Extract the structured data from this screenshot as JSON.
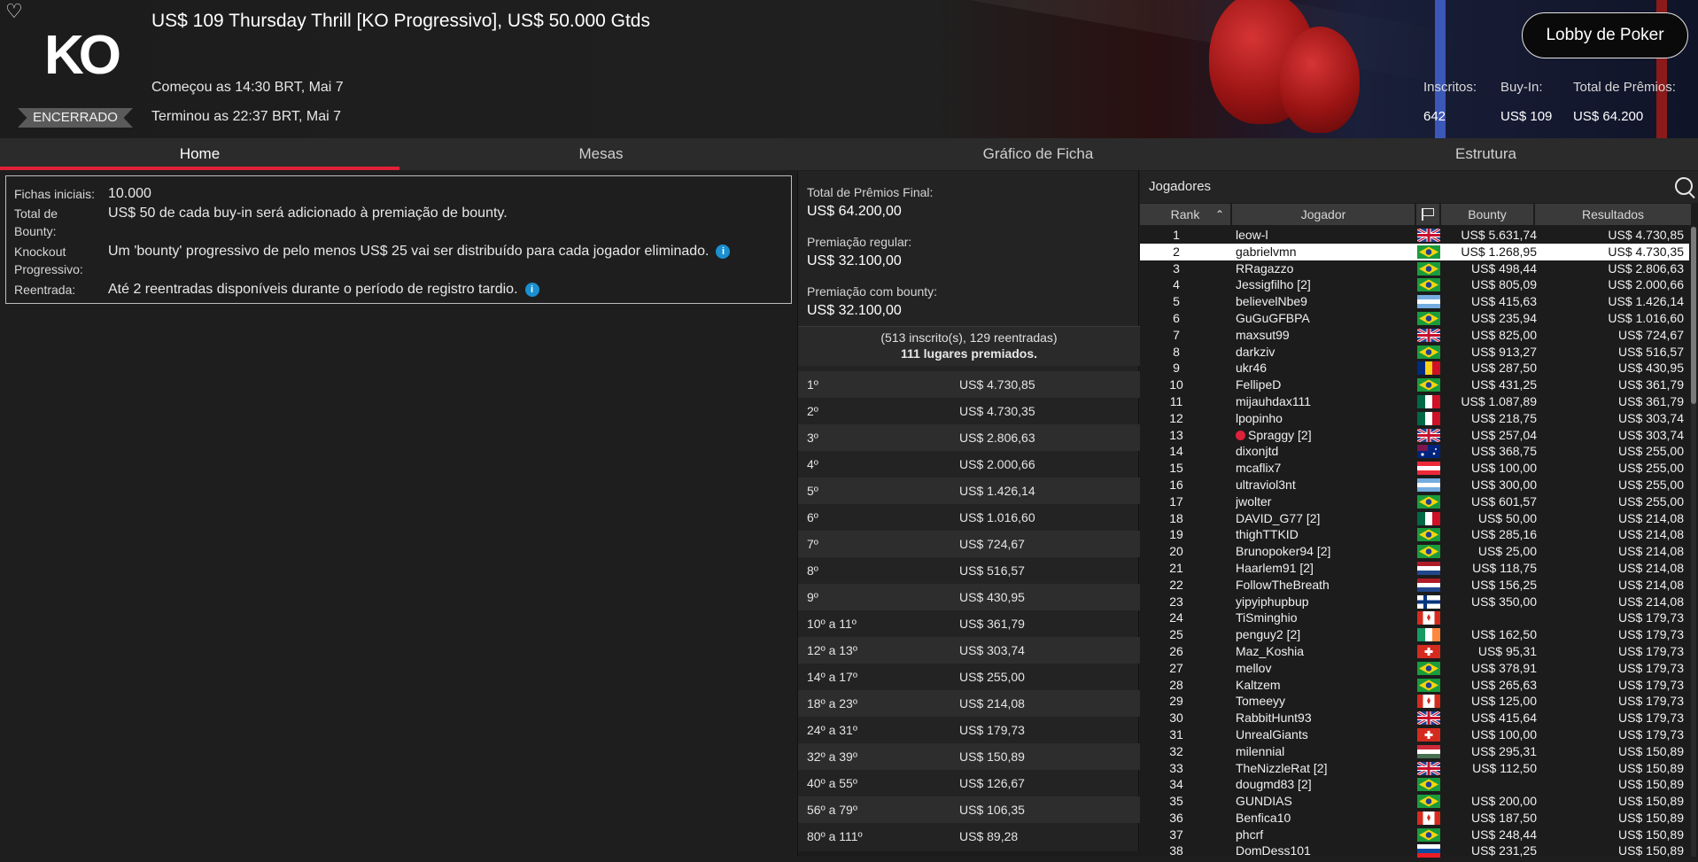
{
  "header": {
    "title": "US$ 109 Thursday Thrill [KO Progressivo], US$ 50.000 Gtds",
    "logo_text": "KO",
    "status": "ENCERRADO",
    "started": "Começou as 14:30 BRT, Mai 7",
    "ended": "Terminou as 22:37 BRT, Mai 7",
    "lobby_button": "Lobby de Poker",
    "stats": {
      "entrants_label": "Inscritos:",
      "entrants_value": "642",
      "buyin_label": "Buy-In:",
      "buyin_value": "US$ 109",
      "prize_label": "Total de Prêmios:",
      "prize_value": "US$ 64.200"
    }
  },
  "tabs": [
    "Home",
    "Mesas",
    "Gráfico de Ficha",
    "Estrutura"
  ],
  "info": [
    {
      "label": "Fichas iniciais:",
      "value": "10.000",
      "icon": false
    },
    {
      "label": "Total de Bounty:",
      "value": "US$ 50 de cada buy-in será adicionado à premiação de bounty.",
      "icon": false
    },
    {
      "label": "Knockout Progressivo:",
      "value": "Um 'bounty' progressivo de pelo menos US$ 25 vai ser distribuído para cada jogador eliminado.",
      "icon": true
    },
    {
      "label": "Reentrada:",
      "value": "Até 2 reentradas disponíveis durante o período de registro tardio.",
      "icon": true
    }
  ],
  "prizes": {
    "final_label": "Total de Prêmios Final:",
    "final_value": "US$ 64.200,00",
    "regular_label": "Premiação regular:",
    "regular_value": "US$ 32.100,00",
    "bounty_label": "Premiação com bounty:",
    "bounty_value": "US$ 32.100,00",
    "entries_line": "(513 inscrito(s), 129 reentradas)",
    "paid_line": "111 lugares premiados.",
    "payouts": [
      {
        "place": "1º",
        "amount": "US$ 4.730,85"
      },
      {
        "place": "2º",
        "amount": "US$ 4.730,35"
      },
      {
        "place": "3º",
        "amount": "US$ 2.806,63"
      },
      {
        "place": "4º",
        "amount": "US$ 2.000,66"
      },
      {
        "place": "5º",
        "amount": "US$ 1.426,14"
      },
      {
        "place": "6º",
        "amount": "US$ 1.016,60"
      },
      {
        "place": "7º",
        "amount": "US$ 724,67"
      },
      {
        "place": "8º",
        "amount": "US$ 516,57"
      },
      {
        "place": "9º",
        "amount": "US$ 430,95"
      },
      {
        "place": "10º a 11º",
        "amount": "US$ 361,79"
      },
      {
        "place": "12º a 13º",
        "amount": "US$ 303,74"
      },
      {
        "place": "14º a 17º",
        "amount": "US$ 255,00"
      },
      {
        "place": "18º a 23º",
        "amount": "US$ 214,08"
      },
      {
        "place": "24º a 31º",
        "amount": "US$ 179,73"
      },
      {
        "place": "32º a 39º",
        "amount": "US$ 150,89"
      },
      {
        "place": "40º a 55º",
        "amount": "US$ 126,67"
      },
      {
        "place": "56º a 79º",
        "amount": "US$ 106,35"
      },
      {
        "place": "80º a 111º",
        "amount": "US$ 89,28"
      }
    ]
  },
  "players": {
    "title": "Jogadores",
    "columns": [
      "Rank",
      "Jogador",
      "Bounty",
      "Resultados"
    ],
    "rows": [
      {
        "rank": "1",
        "name": "leow-l",
        "flag": "gb",
        "bounty": "US$ 5.631,74",
        "result": "US$ 4.730,85"
      },
      {
        "rank": "2",
        "name": "gabrielvmn",
        "flag": "br",
        "bounty": "US$ 1.268,95",
        "result": "US$ 4.730,35"
      },
      {
        "rank": "3",
        "name": "RRagazzo",
        "flag": "br",
        "bounty": "US$ 498,44",
        "result": "US$ 2.806,63"
      },
      {
        "rank": "4",
        "name": "Jessigfilho [2]",
        "flag": "br",
        "bounty": "US$ 805,09",
        "result": "US$ 2.000,66"
      },
      {
        "rank": "5",
        "name": "believelNbe9",
        "flag": "ar",
        "bounty": "US$ 415,63",
        "result": "US$ 1.426,14"
      },
      {
        "rank": "6",
        "name": "GuGuGFBPA",
        "flag": "br",
        "bounty": "US$ 235,94",
        "result": "US$ 1.016,60"
      },
      {
        "rank": "7",
        "name": "maxsut99",
        "flag": "gb",
        "bounty": "US$ 825,00",
        "result": "US$ 724,67"
      },
      {
        "rank": "8",
        "name": "darkziv",
        "flag": "br",
        "bounty": "US$ 913,27",
        "result": "US$ 516,57"
      },
      {
        "rank": "9",
        "name": "ukr46",
        "flag": "ro",
        "bounty": "US$ 287,50",
        "result": "US$ 430,95"
      },
      {
        "rank": "10",
        "name": "FellipeD",
        "flag": "br",
        "bounty": "US$ 431,25",
        "result": "US$ 361,79"
      },
      {
        "rank": "11",
        "name": "mijauhdax111",
        "flag": "mx",
        "bounty": "US$ 1.087,89",
        "result": "US$ 361,79"
      },
      {
        "rank": "12",
        "name": "lpopinho",
        "flag": "mx",
        "bounty": "US$ 218,75",
        "result": "US$ 303,74"
      },
      {
        "rank": "13",
        "name": "Spraggy [2]",
        "flag": "gb",
        "bounty": "US$ 257,04",
        "result": "US$ 303,74",
        "pro": true
      },
      {
        "rank": "14",
        "name": "dixonjtd",
        "flag": "au",
        "bounty": "US$ 368,75",
        "result": "US$ 255,00"
      },
      {
        "rank": "15",
        "name": "mcaflix7",
        "flag": "at",
        "bounty": "US$ 100,00",
        "result": "US$ 255,00"
      },
      {
        "rank": "16",
        "name": "ultraviol3nt",
        "flag": "ar",
        "bounty": "US$ 300,00",
        "result": "US$ 255,00"
      },
      {
        "rank": "17",
        "name": "jwolter",
        "flag": "br",
        "bounty": "US$ 601,57",
        "result": "US$ 255,00"
      },
      {
        "rank": "18",
        "name": "DAVID_G77 [2]",
        "flag": "mx",
        "bounty": "US$ 50,00",
        "result": "US$ 214,08"
      },
      {
        "rank": "19",
        "name": "thighTTKID",
        "flag": "br",
        "bounty": "US$ 285,16",
        "result": "US$ 214,08"
      },
      {
        "rank": "20",
        "name": "Brunopoker94 [2]",
        "flag": "br",
        "bounty": "US$ 25,00",
        "result": "US$ 214,08"
      },
      {
        "rank": "21",
        "name": "Haarlem91 [2]",
        "flag": "nl",
        "bounty": "US$ 118,75",
        "result": "US$ 214,08"
      },
      {
        "rank": "22",
        "name": "FollowTheBreath",
        "flag": "nl",
        "bounty": "US$ 156,25",
        "result": "US$ 214,08"
      },
      {
        "rank": "23",
        "name": "yipyiphupbup",
        "flag": "fi",
        "bounty": "US$ 350,00",
        "result": "US$ 214,08"
      },
      {
        "rank": "24",
        "name": "TiSminghio",
        "flag": "ca",
        "bounty": "",
        "result": "US$ 179,73"
      },
      {
        "rank": "25",
        "name": "penguy2 [2]",
        "flag": "ie",
        "bounty": "US$ 162,50",
        "result": "US$ 179,73"
      },
      {
        "rank": "26",
        "name": "Maz_Koshia",
        "flag": "ch",
        "bounty": "US$ 95,31",
        "result": "US$ 179,73"
      },
      {
        "rank": "27",
        "name": "mellov",
        "flag": "br",
        "bounty": "US$ 378,91",
        "result": "US$ 179,73"
      },
      {
        "rank": "28",
        "name": "Kaltzem",
        "flag": "br",
        "bounty": "US$ 265,63",
        "result": "US$ 179,73"
      },
      {
        "rank": "29",
        "name": "Tomeeyy",
        "flag": "ca",
        "bounty": "US$ 125,00",
        "result": "US$ 179,73"
      },
      {
        "rank": "30",
        "name": "RabbitHunt93",
        "flag": "gb",
        "bounty": "US$ 415,64",
        "result": "US$ 179,73"
      },
      {
        "rank": "31",
        "name": "UnrealGiants",
        "flag": "ch",
        "bounty": "US$ 100,00",
        "result": "US$ 179,73"
      },
      {
        "rank": "32",
        "name": "milennial",
        "flag": "hu",
        "bounty": "US$ 295,31",
        "result": "US$ 150,89"
      },
      {
        "rank": "33",
        "name": "TheNizzleRat [2]",
        "flag": "gb",
        "bounty": "US$ 112,50",
        "result": "US$ 150,89"
      },
      {
        "rank": "34",
        "name": "dougmd83 [2]",
        "flag": "br",
        "bounty": "",
        "result": "US$ 150,89"
      },
      {
        "rank": "35",
        "name": "GUNDIAS",
        "flag": "br",
        "bounty": "US$ 200,00",
        "result": "US$ 150,89"
      },
      {
        "rank": "36",
        "name": "Benfica10",
        "flag": "ca",
        "bounty": "US$ 187,50",
        "result": "US$ 150,89"
      },
      {
        "rank": "37",
        "name": "phcrf",
        "flag": "br",
        "bounty": "US$ 248,44",
        "result": "US$ 150,89"
      },
      {
        "rank": "38",
        "name": "DomDess101",
        "flag": "sk",
        "bounty": "US$ 231,25",
        "result": "US$ 150,89"
      }
    ]
  },
  "colors": {
    "accent": "#e0213a",
    "info": "#1a8fd1",
    "bg": "#1e1e1e"
  }
}
